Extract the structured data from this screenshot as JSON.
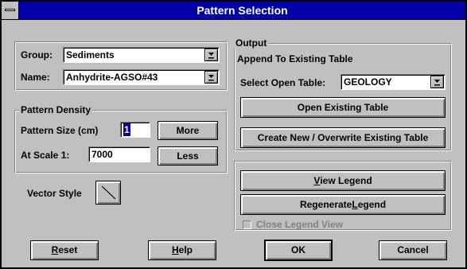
{
  "window": {
    "title": "Pattern Selection"
  },
  "pattern_group": {
    "group_label": "Group:",
    "group_value": "Sediments",
    "name_label": "Name:",
    "name_value": "Anhydrite-AGSO#43"
  },
  "pattern_density": {
    "legend": "Pattern Density",
    "size_label": "Pattern Size (cm)",
    "size_value": "1",
    "scale_label": "At Scale 1:",
    "scale_value": "7000",
    "more_label": "More",
    "less_label": "Less"
  },
  "vector_style": {
    "label": "Vector Style"
  },
  "output": {
    "legend": "Output",
    "append_legend": "Append To Existing Table",
    "select_table_label": "Select Open Table:",
    "select_table_value": "GEOLOGY",
    "open_existing_label": "Open Existing Table",
    "create_new_label": "Create New / Overwrite Existing Table"
  },
  "legend_panel": {
    "view_legend_ul": "V",
    "view_legend_rest": "iew Legend",
    "regen_pre": "Regenerate ",
    "regen_ul": "L",
    "regen_post": "egend",
    "close_legend_label": "Close Legend View"
  },
  "footer": {
    "reset_ul": "R",
    "reset_rest": "eset",
    "help_ul": "H",
    "help_rest": "elp",
    "ok_label": "OK",
    "cancel_label": "Cancel"
  }
}
